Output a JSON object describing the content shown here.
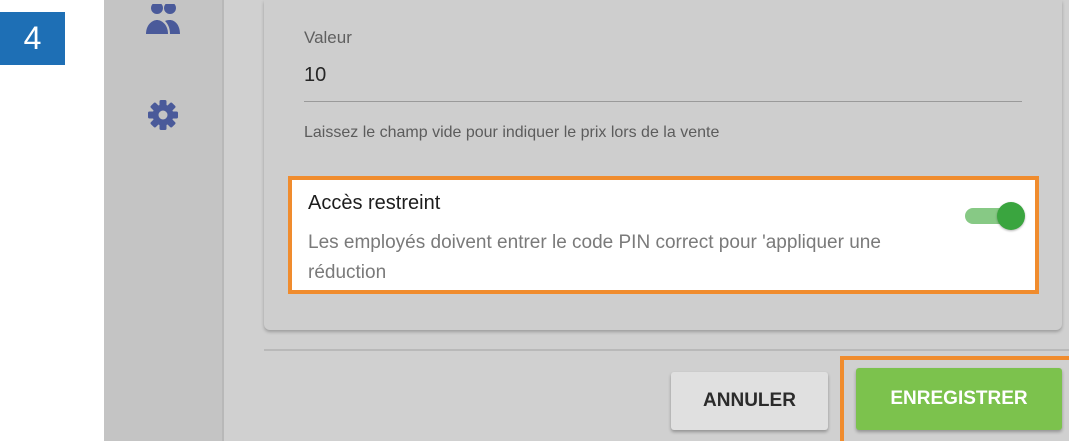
{
  "step": {
    "number": "4"
  },
  "sidebar": {
    "items": [
      {
        "icon": "users-icon"
      },
      {
        "icon": "gear-icon"
      }
    ]
  },
  "form": {
    "value_field": {
      "label": "Valeur",
      "value": "10",
      "hint": "Laissez le champ vide pour indiquer le prix lors de la vente"
    },
    "restricted_access": {
      "title": "Accès restreint",
      "description": "Les employés doivent entrer le code PIN correct pour 'appliquer une réduction",
      "enabled": true
    }
  },
  "actions": {
    "cancel_label": "ANNULER",
    "save_label": "ENREGISTRER"
  },
  "colors": {
    "badge": "#1e6fb5",
    "highlight": "#f08c2e",
    "save_button": "#7cc24d",
    "toggle_on": "#3aa53f",
    "icons": "#4a5a9a"
  }
}
